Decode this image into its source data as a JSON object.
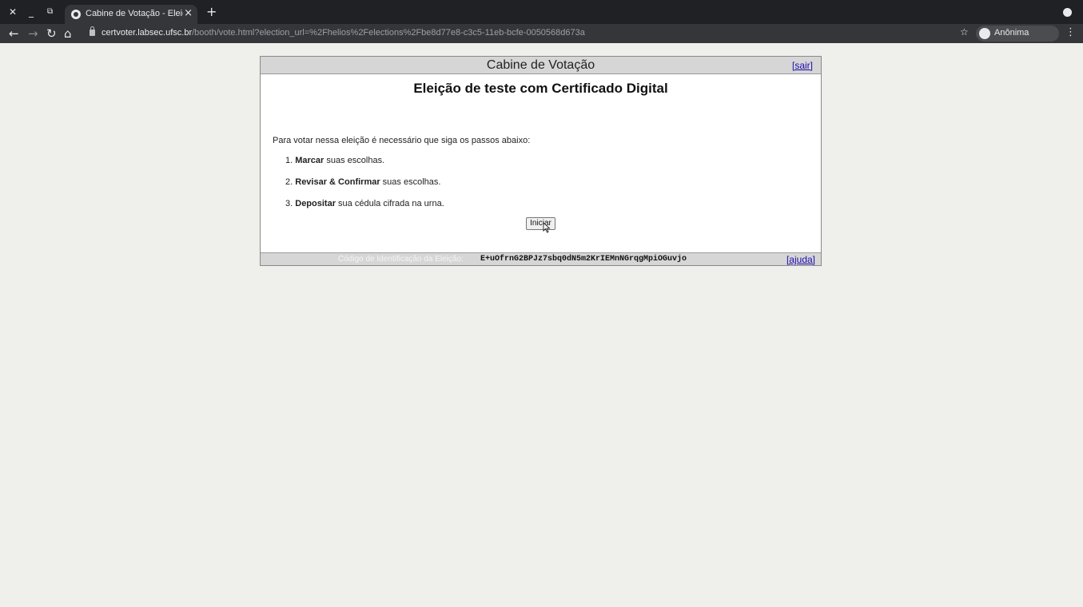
{
  "browser": {
    "tab_title": "Cabine de Votação - Eleição",
    "url_host": "certvoter.labsec.ufsc.br",
    "url_path": "/booth/vote.html?election_url=%2Fhelios%2Felections%2Fbe8d77e8-c3c5-11eb-bcfe-0050568d673a",
    "profile_label": "Anônima"
  },
  "booth": {
    "header_title": "Cabine de Votação",
    "exit_link": "[sair]",
    "election_name": "Eleição de teste com Certificado Digital",
    "intro": "Para votar nessa eleição é necessário que siga os passos abaixo:",
    "steps": [
      {
        "num": "1.",
        "bold": "Marcar",
        "rest": " suas escolhas."
      },
      {
        "num": "2.",
        "bold": "Revisar & Confirmar",
        "rest": " suas escolhas."
      },
      {
        "num": "3.",
        "bold": "Depositar",
        "rest": " sua cédula cifrada na urna."
      }
    ],
    "start_button": "Iniciar",
    "footer_label": "Código de Identificação da Eleição:",
    "footer_code": "E+uOfrnG2BPJz7sbq0dN5m2KrIEMnNGrqgMpiOGuvjo",
    "help_link": "[ajuda]"
  }
}
